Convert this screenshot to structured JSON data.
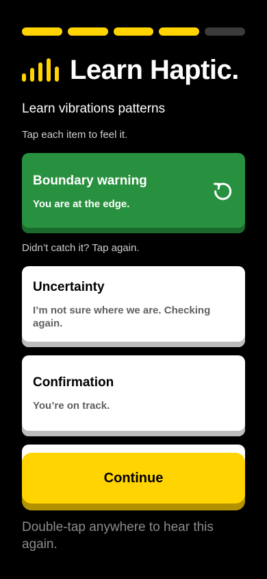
{
  "progress": {
    "total_steps": 5,
    "completed_steps": 4,
    "active_color": "#ffd400",
    "inactive_color": "#3b3b3b"
  },
  "brand": {
    "title": "Learn Haptic.",
    "icon": "haptic-bars-icon"
  },
  "subtitle": "Learn vibrations patterns",
  "hint": "Tap each item to feel it.",
  "active_card": {
    "title": "Boundary warning",
    "subtitle": "You are at the edge.",
    "icon": "replay-icon",
    "color": "#28913f"
  },
  "retry_hint": "Didn’t catch it? Tap again.",
  "cards": [
    {
      "title": "Uncertainty",
      "subtitle": "I’m not sure where we are. Checking again."
    },
    {
      "title": "Confirmation",
      "subtitle": "You’re on track."
    }
  ],
  "continue_button": {
    "label": "Continue",
    "color": "#ffd400"
  },
  "footer": "Double-tap anywhere to hear this again."
}
